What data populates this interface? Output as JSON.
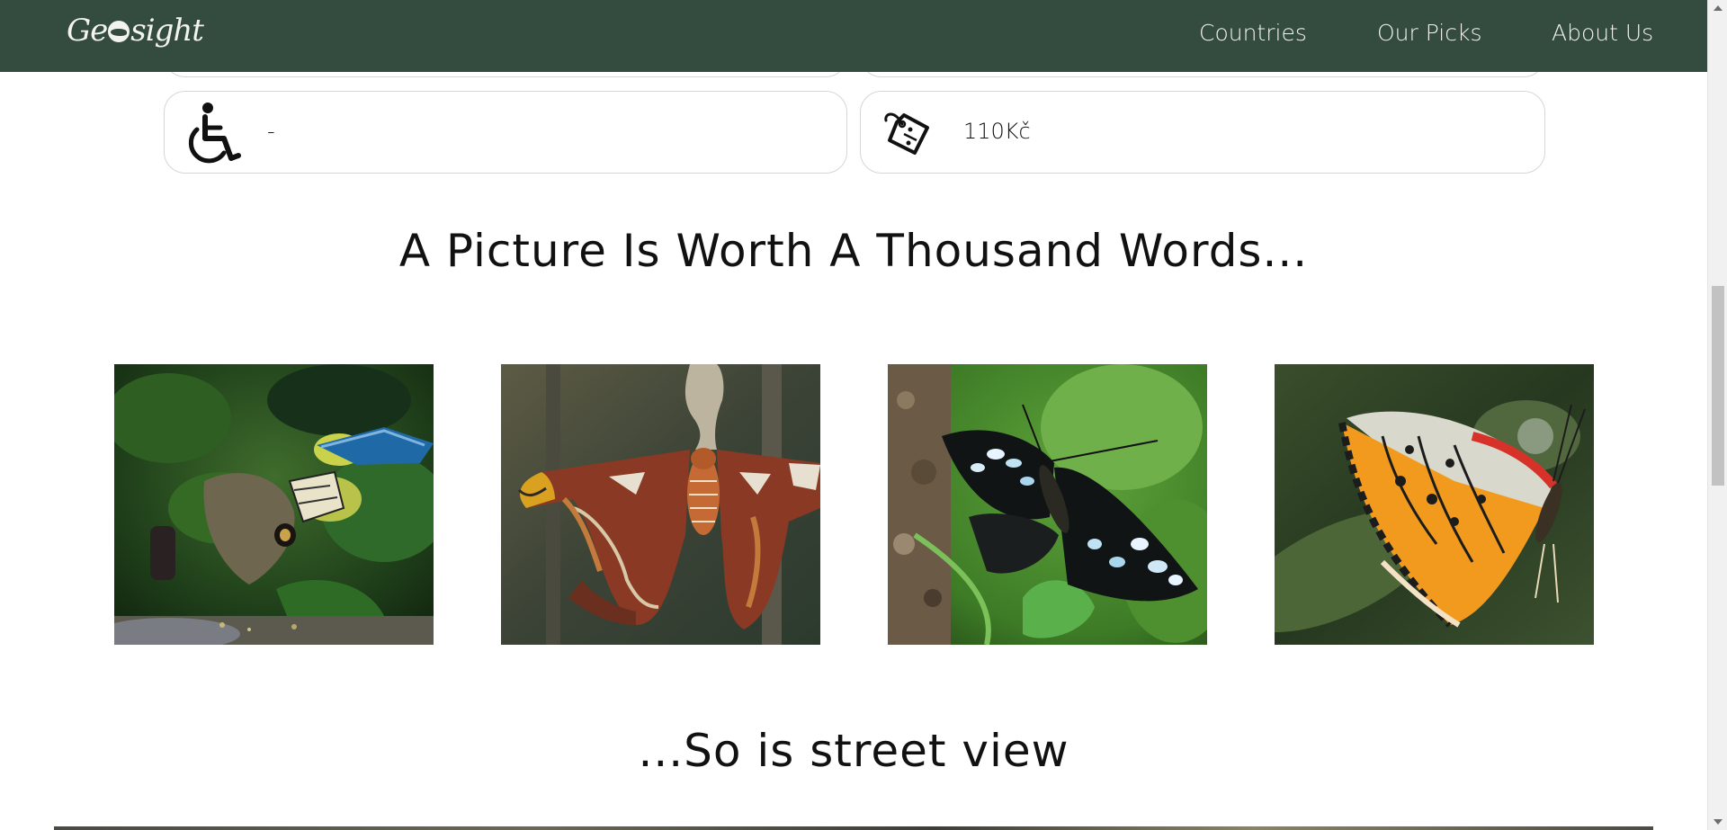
{
  "navbar": {
    "logo_text": "Geosight",
    "logo_pre": "Ge",
    "logo_post": "sight",
    "links": [
      {
        "label": "Countries"
      },
      {
        "label": "Our Picks"
      },
      {
        "label": "About Us"
      }
    ],
    "background_color": "#344b3f"
  },
  "info": {
    "accessibility": {
      "icon": "wheelchair-icon",
      "value": "-"
    },
    "price": {
      "icon": "price-tag-icon",
      "value": "110Kč"
    }
  },
  "gallery": {
    "title": "A Picture Is Worth A Thousand Words...",
    "photos": [
      {
        "subject": "owl-butterfly-and-blue-morpho-photo"
      },
      {
        "subject": "atlas-moth-photo"
      },
      {
        "subject": "blue-clipper-butterfly-photo"
      },
      {
        "subject": "leopard-lacewing-butterfly-photo"
      }
    ]
  },
  "street_view": {
    "title": "...So is street view"
  }
}
